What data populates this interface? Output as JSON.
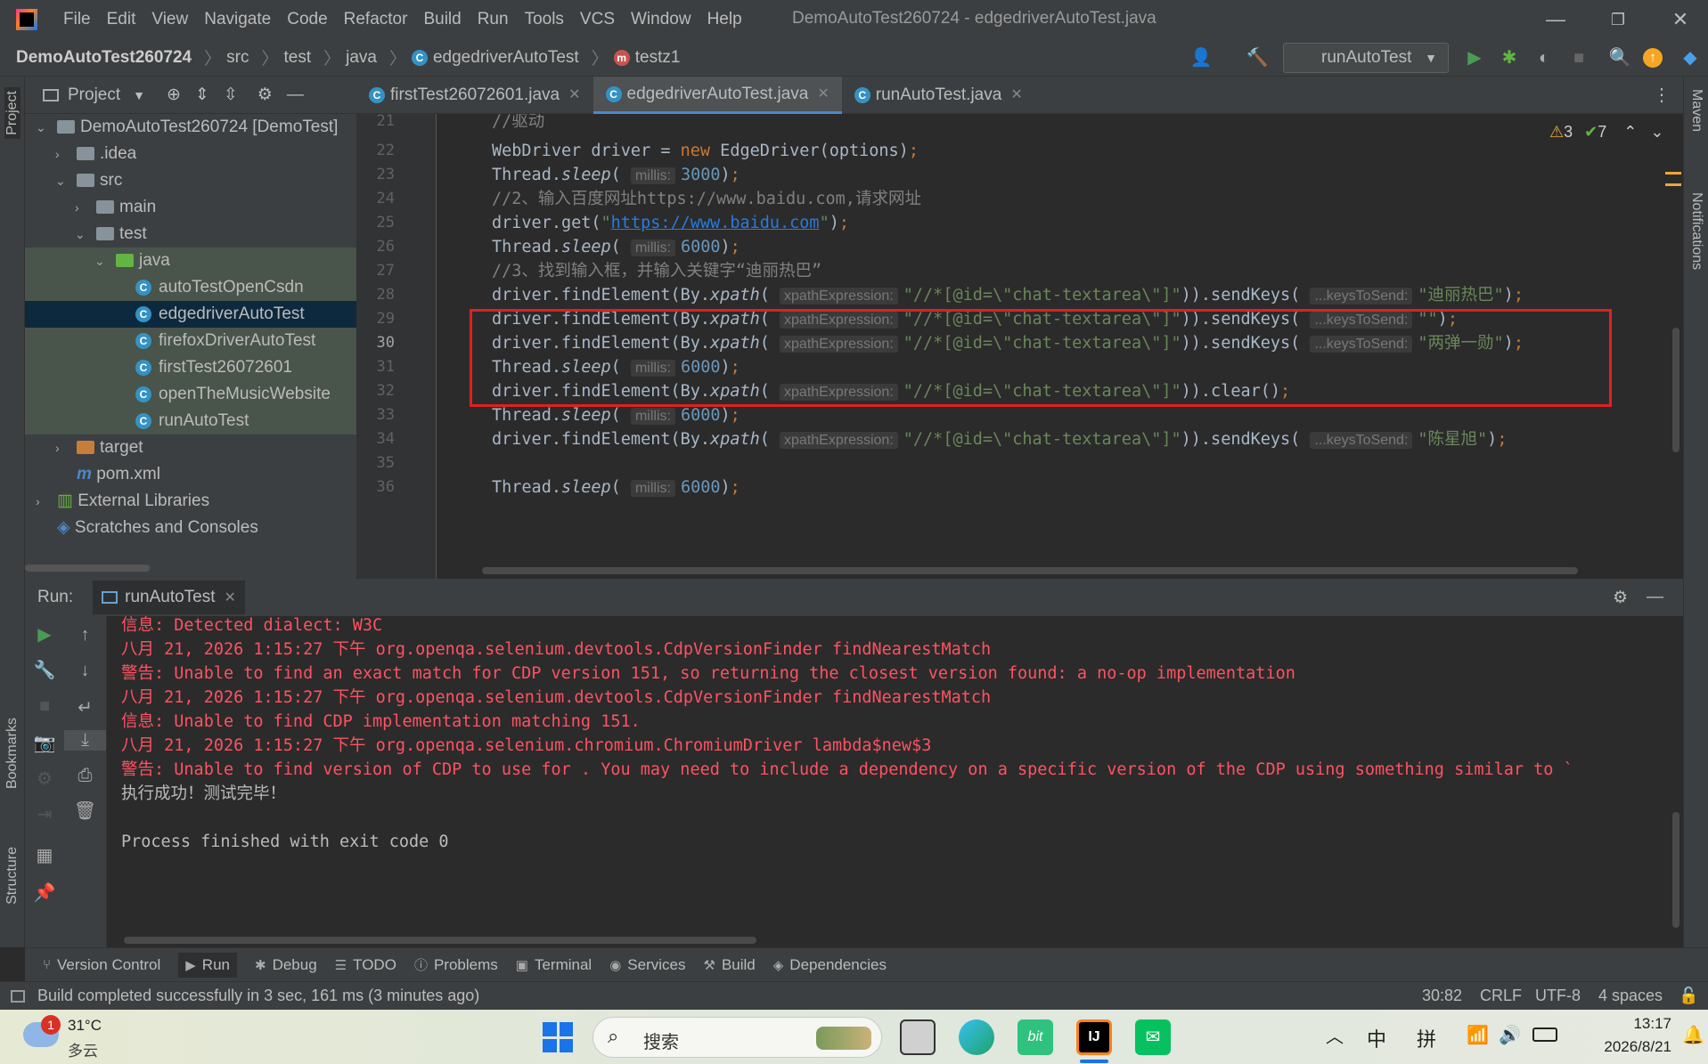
{
  "window": {
    "title": "DemoAutoTest260724 - edgedriverAutoTest.java",
    "menu": [
      "File",
      "Edit",
      "View",
      "Navigate",
      "Code",
      "Refactor",
      "Build",
      "Run",
      "Tools",
      "VCS",
      "Window",
      "Help"
    ]
  },
  "breadcrumb": [
    "DemoAutoTest260724",
    "src",
    "test",
    "java",
    "edgedriverAutoTest",
    "testz1"
  ],
  "toolbar": {
    "run_config": "runAutoTest"
  },
  "project": {
    "header": "Project",
    "tree": [
      {
        "label": "DemoAutoTest260724 [DemoTest]",
        "level": 0,
        "type": "module",
        "expanded": true
      },
      {
        "label": ".idea",
        "level": 1,
        "type": "folder",
        "expanded": false
      },
      {
        "label": "src",
        "level": 1,
        "type": "folder",
        "expanded": true
      },
      {
        "label": "main",
        "level": 2,
        "type": "folder",
        "expanded": false
      },
      {
        "label": "test",
        "level": 2,
        "type": "folder",
        "expanded": true
      },
      {
        "label": "java",
        "level": 3,
        "type": "folder-green",
        "expanded": true
      },
      {
        "label": "autoTestOpenCsdn",
        "level": 4,
        "type": "class"
      },
      {
        "label": "edgedriverAutoTest",
        "level": 4,
        "type": "class",
        "selected": true
      },
      {
        "label": "firefoxDriverAutoTest",
        "level": 4,
        "type": "class"
      },
      {
        "label": "firstTest26072601",
        "level": 4,
        "type": "class"
      },
      {
        "label": "openTheMusicWebsite",
        "level": 4,
        "type": "class"
      },
      {
        "label": "runAutoTest",
        "level": 4,
        "type": "class"
      },
      {
        "label": "target",
        "level": 1,
        "type": "folder-orange",
        "expanded": false
      },
      {
        "label": "pom.xml",
        "level": 1,
        "type": "maven"
      },
      {
        "label": "External Libraries",
        "level": 0,
        "type": "libs",
        "expanded": false
      },
      {
        "label": "Scratches and Consoles",
        "level": 0,
        "type": "scratch"
      }
    ]
  },
  "editor": {
    "tabs": [
      {
        "label": "firstTest26072601.java",
        "active": false
      },
      {
        "label": "edgedriverAutoTest.java",
        "active": true
      },
      {
        "label": "runAutoTest.java",
        "active": false
      }
    ],
    "warnings": "3",
    "checks": "7",
    "lines": [
      {
        "n": "21",
        "code": "//驱动"
      },
      {
        "n": "22",
        "code": "WebDriver driver = new EdgeDriver(options);"
      },
      {
        "n": "23",
        "code": "Thread.sleep( millis: 3000);"
      },
      {
        "n": "24",
        "code": "//2、输入百度网址https://www.baidu.com,请求网址"
      },
      {
        "n": "25",
        "code": "driver.get(\"https://www.baidu.com\");"
      },
      {
        "n": "26",
        "code": "Thread.sleep( millis: 6000);"
      },
      {
        "n": "27",
        "code": "//3、找到输入框，并输入关键字“迪丽热巴”"
      },
      {
        "n": "28",
        "code": "driver.findElement(By.xpath( xpathExpression: \"//*[@id=\\\"chat-textarea\\\"]\")).sendKeys( ...keysToSend: \"迪丽热巴\");"
      },
      {
        "n": "29",
        "code": "driver.findElement(By.xpath( xpathExpression: \"//*[@id=\\\"chat-textarea\\\"]\")).sendKeys( ...keysToSend: \"\");"
      },
      {
        "n": "30",
        "code": "driver.findElement(By.xpath( xpathExpression: \"//*[@id=\\\"chat-textarea\\\"]\")).sendKeys( ...keysToSend: \"两弹一勋\");"
      },
      {
        "n": "31",
        "code": "Thread.sleep( millis: 6000);"
      },
      {
        "n": "32",
        "code": "driver.findElement(By.xpath( xpathExpression: \"//*[@id=\\\"chat-textarea\\\"]\")).clear();"
      },
      {
        "n": "33",
        "code": "Thread.sleep( millis: 6000);"
      },
      {
        "n": "34",
        "code": "driver.findElement(By.xpath( xpathExpression: \"//*[@id=\\\"chat-textarea\\\"]\")).sendKeys( ...keysToSend: \"陈星旭\");"
      },
      {
        "n": "35",
        "code": ""
      },
      {
        "n": "36",
        "code": "Thread.sleep( millis: 6000);"
      }
    ],
    "hints": {
      "millis": "millis:",
      "xpath": "xpathExpression:",
      "keys": "...keysToSend:"
    },
    "strings": {
      "xpath": "\"//*[@id=\\\"chat-textarea\\\"]\"",
      "url": "https://www.baidu.com",
      "k28": "\"迪丽热巴\"",
      "k29": "\"\"",
      "k30": "\"两弹一勋\"",
      "k34": "\"陈星旭\""
    },
    "numbers": {
      "n3000": "3000",
      "n6000": "6000"
    },
    "comments": {
      "c21": "//驱动",
      "c24": "//2、输入百度网址https://www.baidu.com,请求网址",
      "c27": "//3、找到输入框，并输入关键字“迪丽热巴”"
    }
  },
  "run": {
    "label": "Run:",
    "tab": "runAutoTest",
    "output": [
      {
        "text": "信息: Detected dialect: W3C",
        "color": "red"
      },
      {
        "text": "八月 21, 2026 1:15:27 下午 org.openqa.selenium.devtools.CdpVersionFinder findNearestMatch",
        "color": "red"
      },
      {
        "text": "警告: Unable to find an exact match for CDP version 151, so returning the closest version found: a no-op implementation",
        "color": "red"
      },
      {
        "text": "八月 21, 2026 1:15:27 下午 org.openqa.selenium.devtools.CdpVersionFinder findNearestMatch",
        "color": "red"
      },
      {
        "text": "信息: Unable to find CDP implementation matching 151.",
        "color": "red"
      },
      {
        "text": "八月 21, 2026 1:15:27 下午 org.openqa.selenium.chromium.ChromiumDriver lambda$new$3",
        "color": "red"
      },
      {
        "text": "警告: Unable to find version of CDP to use for . You may need to include a dependency on a specific version of the CDP using something similar to `",
        "color": "red"
      },
      {
        "text": "执行成功！测试完毕！",
        "color": "white"
      },
      {
        "text": "",
        "color": "white"
      },
      {
        "text": "Process finished with exit code 0",
        "color": "white"
      }
    ]
  },
  "bottom_tabs": [
    "Version Control",
    "Run",
    "Debug",
    "TODO",
    "Problems",
    "Terminal",
    "Services",
    "Build",
    "Dependencies"
  ],
  "status": {
    "message": "Build completed successfully in 3 sec, 161 ms (3 minutes ago)",
    "position": "30:82",
    "line_sep": "CRLF",
    "encoding": "UTF-8",
    "indent": "4 spaces"
  },
  "side": {
    "project": "Project",
    "bookmarks": "Bookmarks",
    "structure": "Structure",
    "maven": "Maven",
    "notifications": "Notifications"
  },
  "taskbar": {
    "weather_temp": "31°C",
    "weather_desc": "多云",
    "weather_badge": "1",
    "search_placeholder": "搜索",
    "tray_ime1": "中",
    "tray_ime2": "拼",
    "time": "13:17",
    "date": "2026/8/21"
  },
  "colors": {
    "accent": "#4a88c7",
    "error_text": "#ff5261",
    "highlight_box": "#e02020"
  }
}
